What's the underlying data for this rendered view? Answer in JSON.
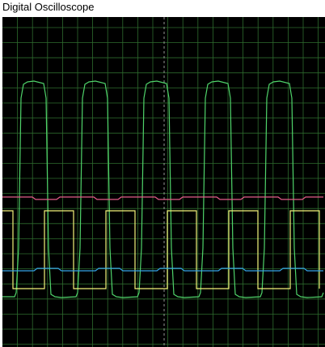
{
  "window": {
    "title": "Digital Oscilloscope"
  },
  "scope": {
    "background": "#000000",
    "grid_color": "#2e6b2e",
    "center_line_color": "#b8b8b8",
    "traces": [
      {
        "name": "",
        "color": "#4fd36a"
      },
      {
        "name": "",
        "color": "#e45c8a"
      },
      {
        "name": "",
        "color": "#f2f27a"
      },
      {
        "name": "",
        "color": "#35a4e6"
      }
    ]
  }
}
